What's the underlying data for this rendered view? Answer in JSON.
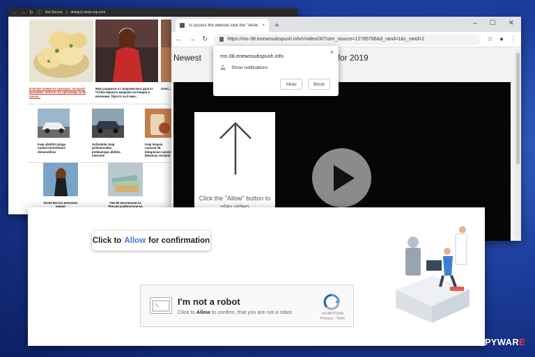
{
  "news_window": {
    "insecure_label": "Not Secure",
    "url": "design2.news-top.com",
    "top_tiles": [
      {
        "caption": "В Литве появился препарат, который вызывает аппетит но организму за 48 часов..."
      },
      {
        "caption": "Муж уходился от супружеского долга? Чтобы вернуть мощную потенцию и влечение. Просто на 5 мин..."
      },
      {
        "caption": "Omsl..."
      }
    ],
    "mid_tiles": [
      {
        "caption": "Kaip uždirbti pinigų nuolat internetinius dienoraščius"
      },
      {
        "caption": "Sužinokite, kaip profesionalūs prekiautojai uždirba internete"
      },
      {
        "caption": "Kaip lengvai numesti 28 kilogramus namie! (Maemus recepte)"
      }
    ],
    "bottom_tiles": [
      {
        "caption": "Юлия Бегеча внезапно парад!"
      },
      {
        "caption": "Уже 80 миллионов из Россия разбогатели на этой схеме"
      }
    ]
  },
  "chrome_window": {
    "tab_title": "To access the website click the \"Allow\"",
    "tab_close": "×",
    "new_tab": "+",
    "window_controls": [
      "–",
      "☐",
      "✕"
    ],
    "url": "https://ms-38.enewssubspush.info/r/video/30?utm_source=12785766&d_rand=1&c_rand=2",
    "headline_left": "Newest",
    "headline_right": "lar for 2019",
    "arrow_text": "Click the \"Allow\" button to play video"
  },
  "permission_prompt": {
    "site": "ms-38.enewssubspush.info",
    "message": "Show notifications",
    "allow_label": "Allow",
    "block_label": "Block",
    "close": "×"
  },
  "captcha_window": {
    "confirm_prefix": "Click to",
    "confirm_highlight": "Allow",
    "confirm_suffix": "for confirmation",
    "robot_title": "I'm not a robot",
    "robot_prefix": "Click to",
    "robot_bold": "Allow",
    "robot_suffix": "to confirm, that you are not a robot",
    "recaptcha_label": "reCAPTCHA",
    "recaptcha_links": "Privacy - Term"
  },
  "watermark": {
    "num": "2",
    "spy": "SPYWAR",
    "e": "E"
  },
  "colors": {
    "accent_blue": "#3b7ad9",
    "background_blue": "#1d3f9e"
  }
}
